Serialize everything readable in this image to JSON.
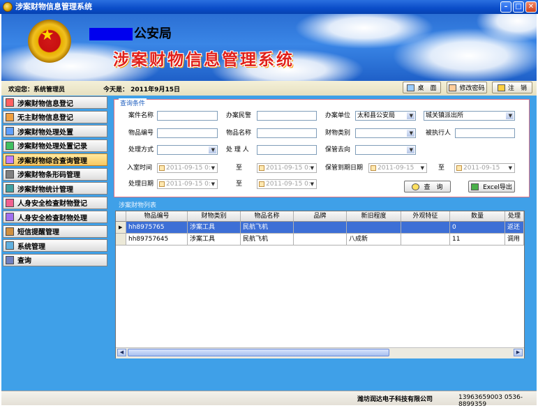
{
  "window": {
    "title": "涉案财物信息管理系统",
    "min": "–",
    "max": "□",
    "close": "✕"
  },
  "banner": {
    "bureau": "公安局",
    "system_title": "涉案财物信息管理系统"
  },
  "statusbar": {
    "welcome": "欢迎您：系统管理员",
    "today": "今天是： 2011年9月15日",
    "desktop_btn": "桌　面",
    "change_pwd_btn": "修改密码",
    "logout_btn": "注　销"
  },
  "sidebar": {
    "items": [
      {
        "label": "涉案财物信息登记",
        "icon": "form-icon"
      },
      {
        "label": "无主财物信息登记",
        "icon": "box-icon"
      },
      {
        "label": "涉案财物处理处置",
        "icon": "chart-icon"
      },
      {
        "label": "涉案财物处理处置记录",
        "icon": "check-icon"
      },
      {
        "label": "涉案财物综合查询管理",
        "icon": "search-icon",
        "active": true
      },
      {
        "label": "涉案财物条形码管理",
        "icon": "barcode-icon"
      },
      {
        "label": "涉案财物统计管理",
        "icon": "stats-icon"
      },
      {
        "label": "人身安全检查财物登记",
        "icon": "person-icon"
      },
      {
        "label": "人身安全检查财物处理",
        "icon": "person-process-icon"
      },
      {
        "label": "短信提醒管理",
        "icon": "sms-icon"
      },
      {
        "label": "系统管理",
        "icon": "settings-icon"
      },
      {
        "label": "查询",
        "icon": "query-icon"
      }
    ]
  },
  "query": {
    "legend": "查询条件",
    "case_name": "案件名称",
    "officer": "办案民警",
    "unit": "办案单位",
    "unit_value": "太和县公安局",
    "station_value": "城关镇派出所",
    "item_no": "物品编号",
    "item_name": "物品名称",
    "category": "财物类别",
    "executor": "被执行人",
    "disposal_method": "处理方式",
    "handler": "处 理 人",
    "storage": "保管去向",
    "storage_time": "入室时间",
    "to1": "至",
    "expire_date": "保管到期日期",
    "to2": "至",
    "disposal_date": "处理日期",
    "to3": "至",
    "date_a": "2011-09-15 0:",
    "date_b": "2011-09-15 0:",
    "date_c": "2011-09-15",
    "date_d": "2011-09-15",
    "date_e": "2011-09-15 0:",
    "date_f": "2011-09-15 0:",
    "search_btn": "查　询",
    "excel_btn": "Excel导出"
  },
  "list": {
    "legend": "涉案财物列表",
    "columns": [
      "物品编号",
      "财物类别",
      "物品名称",
      "品牌",
      "新旧程度",
      "外观特征",
      "数量",
      "处理"
    ],
    "rows": [
      [
        "hh8975765",
        "涉案工具",
        "民航飞机",
        "",
        "",
        "",
        "0",
        "返还"
      ],
      [
        "hh89757645",
        "涉案工具",
        "民航飞机",
        "",
        "八成新",
        "",
        "11",
        "调用"
      ]
    ],
    "current_row_marker": "▶"
  },
  "footer": {
    "company": "潍坊润达电子科技有限公司",
    "phones": "13963659003  0536-8899359"
  }
}
